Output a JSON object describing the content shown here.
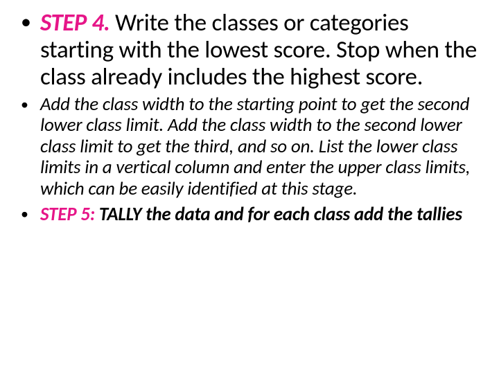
{
  "bullets": {
    "b1": {
      "label": "STEP 4.",
      "body": "   Write the classes or categories starting with the lowest score.  Stop when the class already includes the highest score."
    },
    "b2": {
      "text": "Add the class width to the starting point to get the second lower class limit.  Add the class width to the second lower class limit to get the third, and so on.  List the lower class limits in a vertical column and enter the upper class limits, which can be easily identified at this stage."
    },
    "b3": {
      "label": "STEP 5:",
      "body": " TALLY the data  and for each class add the tallies"
    }
  }
}
